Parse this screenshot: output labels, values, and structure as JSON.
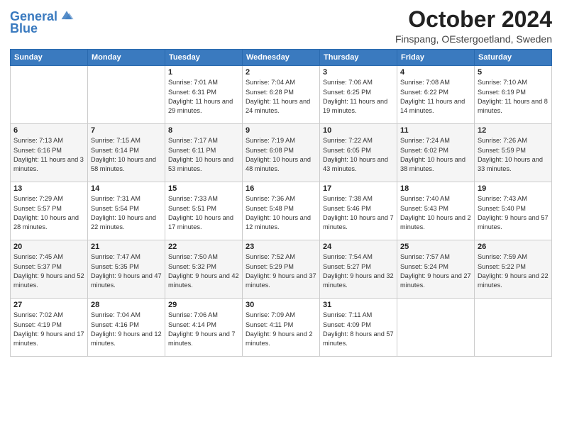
{
  "header": {
    "logo_line1": "General",
    "logo_line2": "Blue",
    "month": "October 2024",
    "location": "Finspang, OEstergoetland, Sweden"
  },
  "weekdays": [
    "Sunday",
    "Monday",
    "Tuesday",
    "Wednesday",
    "Thursday",
    "Friday",
    "Saturday"
  ],
  "weeks": [
    [
      {
        "day": "",
        "info": ""
      },
      {
        "day": "",
        "info": ""
      },
      {
        "day": "1",
        "info": "Sunrise: 7:01 AM\nSunset: 6:31 PM\nDaylight: 11 hours and 29 minutes."
      },
      {
        "day": "2",
        "info": "Sunrise: 7:04 AM\nSunset: 6:28 PM\nDaylight: 11 hours and 24 minutes."
      },
      {
        "day": "3",
        "info": "Sunrise: 7:06 AM\nSunset: 6:25 PM\nDaylight: 11 hours and 19 minutes."
      },
      {
        "day": "4",
        "info": "Sunrise: 7:08 AM\nSunset: 6:22 PM\nDaylight: 11 hours and 14 minutes."
      },
      {
        "day": "5",
        "info": "Sunrise: 7:10 AM\nSunset: 6:19 PM\nDaylight: 11 hours and 8 minutes."
      }
    ],
    [
      {
        "day": "6",
        "info": "Sunrise: 7:13 AM\nSunset: 6:16 PM\nDaylight: 11 hours and 3 minutes."
      },
      {
        "day": "7",
        "info": "Sunrise: 7:15 AM\nSunset: 6:14 PM\nDaylight: 10 hours and 58 minutes."
      },
      {
        "day": "8",
        "info": "Sunrise: 7:17 AM\nSunset: 6:11 PM\nDaylight: 10 hours and 53 minutes."
      },
      {
        "day": "9",
        "info": "Sunrise: 7:19 AM\nSunset: 6:08 PM\nDaylight: 10 hours and 48 minutes."
      },
      {
        "day": "10",
        "info": "Sunrise: 7:22 AM\nSunset: 6:05 PM\nDaylight: 10 hours and 43 minutes."
      },
      {
        "day": "11",
        "info": "Sunrise: 7:24 AM\nSunset: 6:02 PM\nDaylight: 10 hours and 38 minutes."
      },
      {
        "day": "12",
        "info": "Sunrise: 7:26 AM\nSunset: 5:59 PM\nDaylight: 10 hours and 33 minutes."
      }
    ],
    [
      {
        "day": "13",
        "info": "Sunrise: 7:29 AM\nSunset: 5:57 PM\nDaylight: 10 hours and 28 minutes."
      },
      {
        "day": "14",
        "info": "Sunrise: 7:31 AM\nSunset: 5:54 PM\nDaylight: 10 hours and 22 minutes."
      },
      {
        "day": "15",
        "info": "Sunrise: 7:33 AM\nSunset: 5:51 PM\nDaylight: 10 hours and 17 minutes."
      },
      {
        "day": "16",
        "info": "Sunrise: 7:36 AM\nSunset: 5:48 PM\nDaylight: 10 hours and 12 minutes."
      },
      {
        "day": "17",
        "info": "Sunrise: 7:38 AM\nSunset: 5:46 PM\nDaylight: 10 hours and 7 minutes."
      },
      {
        "day": "18",
        "info": "Sunrise: 7:40 AM\nSunset: 5:43 PM\nDaylight: 10 hours and 2 minutes."
      },
      {
        "day": "19",
        "info": "Sunrise: 7:43 AM\nSunset: 5:40 PM\nDaylight: 9 hours and 57 minutes."
      }
    ],
    [
      {
        "day": "20",
        "info": "Sunrise: 7:45 AM\nSunset: 5:37 PM\nDaylight: 9 hours and 52 minutes."
      },
      {
        "day": "21",
        "info": "Sunrise: 7:47 AM\nSunset: 5:35 PM\nDaylight: 9 hours and 47 minutes."
      },
      {
        "day": "22",
        "info": "Sunrise: 7:50 AM\nSunset: 5:32 PM\nDaylight: 9 hours and 42 minutes."
      },
      {
        "day": "23",
        "info": "Sunrise: 7:52 AM\nSunset: 5:29 PM\nDaylight: 9 hours and 37 minutes."
      },
      {
        "day": "24",
        "info": "Sunrise: 7:54 AM\nSunset: 5:27 PM\nDaylight: 9 hours and 32 minutes."
      },
      {
        "day": "25",
        "info": "Sunrise: 7:57 AM\nSunset: 5:24 PM\nDaylight: 9 hours and 27 minutes."
      },
      {
        "day": "26",
        "info": "Sunrise: 7:59 AM\nSunset: 5:22 PM\nDaylight: 9 hours and 22 minutes."
      }
    ],
    [
      {
        "day": "27",
        "info": "Sunrise: 7:02 AM\nSunset: 4:19 PM\nDaylight: 9 hours and 17 minutes."
      },
      {
        "day": "28",
        "info": "Sunrise: 7:04 AM\nSunset: 4:16 PM\nDaylight: 9 hours and 12 minutes."
      },
      {
        "day": "29",
        "info": "Sunrise: 7:06 AM\nSunset: 4:14 PM\nDaylight: 9 hours and 7 minutes."
      },
      {
        "day": "30",
        "info": "Sunrise: 7:09 AM\nSunset: 4:11 PM\nDaylight: 9 hours and 2 minutes."
      },
      {
        "day": "31",
        "info": "Sunrise: 7:11 AM\nSunset: 4:09 PM\nDaylight: 8 hours and 57 minutes."
      },
      {
        "day": "",
        "info": ""
      },
      {
        "day": "",
        "info": ""
      }
    ]
  ]
}
